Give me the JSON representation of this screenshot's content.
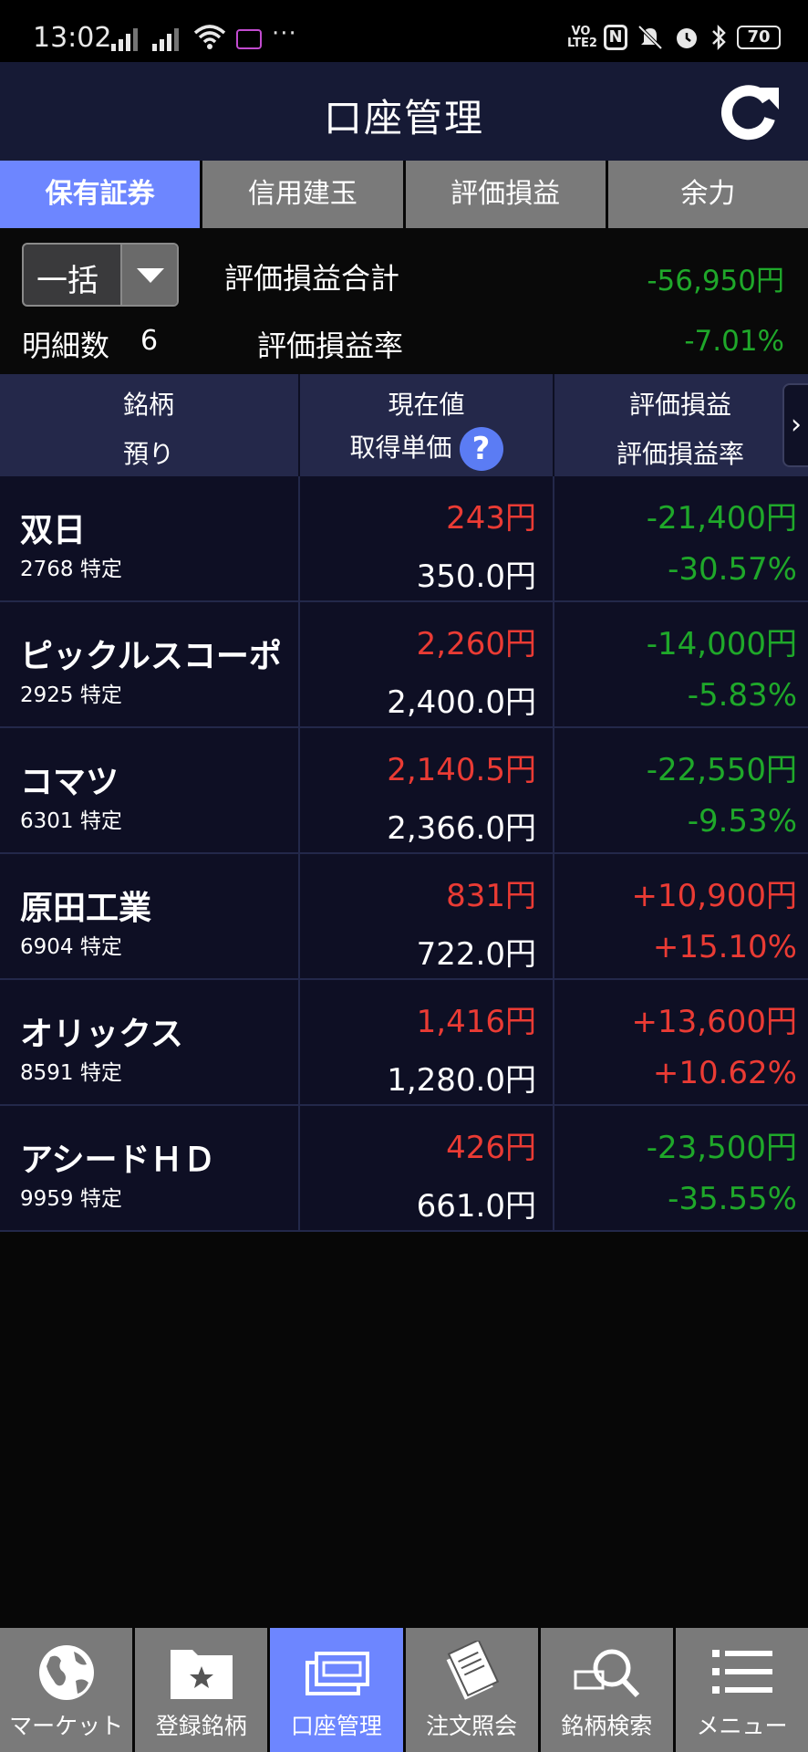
{
  "status_bar": {
    "time": "13:02",
    "dots": "···",
    "volte": "VO LTE2",
    "nfc": "N",
    "battery": "70"
  },
  "header": {
    "title": "口座管理",
    "refresh_icon": "refresh-icon"
  },
  "tabs": [
    {
      "label": "保有証券",
      "active": true
    },
    {
      "label": "信用建玉",
      "active": false
    },
    {
      "label": "評価損益",
      "active": false
    },
    {
      "label": "余力",
      "active": false
    }
  ],
  "summary": {
    "dropdown_value": "一括",
    "total_label": "評価損益合計",
    "total_value": "-56,950円",
    "count_label": "明細数",
    "count_value": "6",
    "rate_label": "評価損益率",
    "rate_value": "-7.01%"
  },
  "table_header": {
    "col1_top": "銘柄",
    "col1_bottom": "預り",
    "col2_top": "現在値",
    "col2_bottom": "取得単価",
    "col3_top": "評価損益",
    "col3_bottom": "評価損益率",
    "help_icon": "?",
    "scroll_icon": "›"
  },
  "holdings": [
    {
      "name": "双日",
      "code": "2768 特定",
      "price": "243円",
      "cost": "350.0円",
      "pl": "-21,400円",
      "rate": "-30.57%",
      "sign": "neg"
    },
    {
      "name": "ピックルスコーポ",
      "code": "2925 特定",
      "price": "2,260円",
      "cost": "2,400.0円",
      "pl": "-14,000円",
      "rate": "-5.83%",
      "sign": "neg"
    },
    {
      "name": "コマツ",
      "code": "6301 特定",
      "price": "2,140.5円",
      "cost": "2,366.0円",
      "pl": "-22,550円",
      "rate": "-9.53%",
      "sign": "neg"
    },
    {
      "name": "原田工業",
      "code": "6904 特定",
      "price": "831円",
      "cost": "722.0円",
      "pl": "+10,900円",
      "rate": "+15.10%",
      "sign": "pos"
    },
    {
      "name": "オリックス",
      "code": "8591 特定",
      "price": "1,416円",
      "cost": "1,280.0円",
      "pl": "+13,600円",
      "rate": "+10.62%",
      "sign": "pos"
    },
    {
      "name": "アシードＨＤ",
      "code": "9959 特定",
      "price": "426円",
      "cost": "661.0円",
      "pl": "-23,500円",
      "rate": "-35.55%",
      "sign": "neg"
    }
  ],
  "bottom_nav": [
    {
      "label": "マーケット",
      "icon": "globe-icon",
      "active": false
    },
    {
      "label": "登録銘柄",
      "icon": "star-folder-icon",
      "active": false
    },
    {
      "label": "口座管理",
      "icon": "account-icon",
      "active": true
    },
    {
      "label": "注文照会",
      "icon": "documents-icon",
      "active": false
    },
    {
      "label": "銘柄検索",
      "icon": "search-icon",
      "active": false
    },
    {
      "label": "メニュー",
      "icon": "menu-icon",
      "active": false
    }
  ],
  "colors": {
    "accent": "#6d86ff",
    "header_bg": "#161a35",
    "gain": "#ea3b34",
    "loss": "#1fa82a"
  }
}
